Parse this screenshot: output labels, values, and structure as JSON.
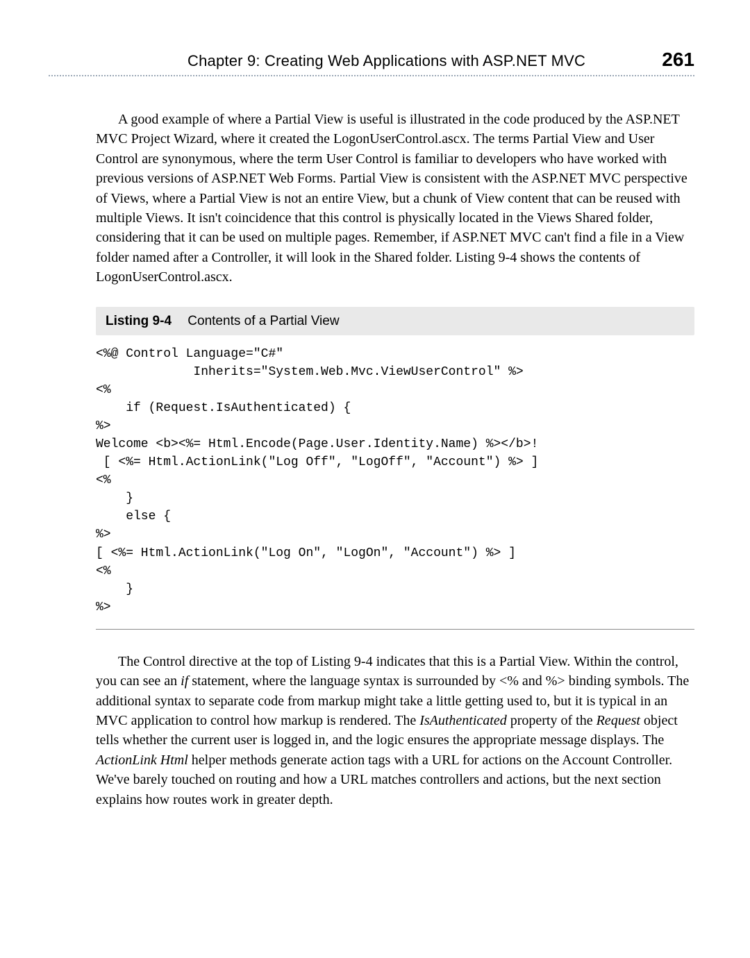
{
  "header": {
    "chapter_label": "Chapter 9:   Creating Web Applications with ASP.NET MVC",
    "page_number": "261"
  },
  "paragraphs": {
    "p1": "A good example of where a Partial View is useful is illustrated in the code produced by the ASP.NET MVC Project Wizard, where it created the LogonUserControl.ascx. The terms Partial View and User Control are synonymous, where the term User Control is familiar to developers who have worked with previous versions of ASP.NET Web Forms. Partial View is consistent with the ASP.NET MVC perspective of Views, where a Partial View is not an entire View, but a chunk of View content that can be reused with multiple Views. It isn't coincidence that this control is physically located in the Views Shared folder, considering that it can be used on multiple pages. Remember, if ASP.NET MVC can't find a file in a View folder named after a Controller, it will look in the Shared folder. Listing 9-4 shows the contents of LogonUserControl.ascx.",
    "p2_a": "The Control directive at the top of Listing 9-4 indicates that this is a Partial View. Within the control, you can see an ",
    "p2_if": "if",
    "p2_b": " statement, where the language syntax is surrounded by <% and %> binding symbols. The additional syntax to separate code from markup might take a little getting used to, but it is typical in an MVC application to control how markup is rendered. The ",
    "p2_isauth": "IsAuthenticated",
    "p2_c": " property of the ",
    "p2_request": "Request",
    "p2_d": " object tells whether the current user is logged in, and the logic ensures the appropriate message displays. The ",
    "p2_actionlink": "ActionLink Html",
    "p2_e": " helper methods generate action tags with a URL for actions on the Account Controller. We've barely touched on routing and how a URL matches controllers and actions, but the next section explains how routes work in greater depth."
  },
  "listing": {
    "label": "Listing 9-4",
    "title": "Contents of a Partial View",
    "code": "<%@ Control Language=\"C#\"\n             Inherits=\"System.Web.Mvc.ViewUserControl\" %>\n<%\n    if (Request.IsAuthenticated) {\n%>\nWelcome <b><%= Html.Encode(Page.User.Identity.Name) %></b>!\n [ <%= Html.ActionLink(\"Log Off\", \"LogOff\", \"Account\") %> ]\n<%\n    }\n    else {\n%>\n[ <%= Html.ActionLink(\"Log On\", \"LogOn\", \"Account\") %> ]\n<%\n    }\n%>"
  }
}
